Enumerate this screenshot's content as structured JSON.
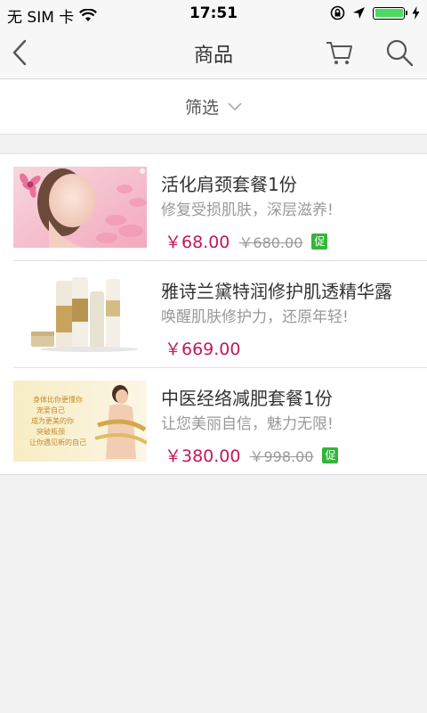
{
  "status_bar": {
    "carrier": "无 SIM 卡",
    "time": "17:51",
    "battery_level": 1.0
  },
  "nav": {
    "title": "商品",
    "icons": [
      "back-chevron-icon",
      "cart-icon",
      "search-icon"
    ]
  },
  "filter": {
    "label": "筛选",
    "icon": "chevron-down-icon"
  },
  "products": [
    {
      "name": "活化肩颈套餐1份",
      "desc": "修复受损肌肤，深层滋养!",
      "price": "￥68.00",
      "orig_price": "￥680.00",
      "promo": "促"
    },
    {
      "name": "雅诗兰黛特润修护肌透精华露",
      "desc": "唤醒肌肤修护力，还原年轻!",
      "price": "￥669.00",
      "orig_price": "",
      "promo": ""
    },
    {
      "name": "中医经络减肥套餐1份",
      "desc": "让您美丽自信，魅力无限!",
      "price": "￥380.00",
      "orig_price": "￥998.00",
      "promo": "促",
      "image_text": [
        "身体比你更懂你",
        "宠爱自己",
        "成为更美的你",
        "突破瓶颈",
        "让你遇见新的自己"
      ]
    }
  ],
  "colors": {
    "price": "#c2185b",
    "promo": "#34b53a",
    "battery": "#4cd964"
  }
}
